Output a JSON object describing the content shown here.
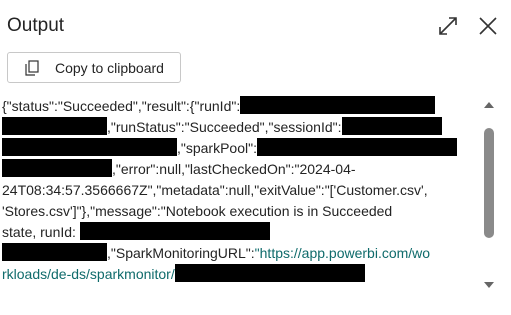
{
  "panel": {
    "title": "Output"
  },
  "toolbar": {
    "copy_label": "Copy to clipboard"
  },
  "icons": {
    "expand": "expand-icon",
    "close": "close-icon",
    "copy": "copy-icon"
  },
  "output": {
    "l1": "{\"status\":\"Succeeded\",\"result\":{\"runId\":",
    "l2": ",\"runStatus\":\"Succeeded\",\"sessionId\":",
    "l3": ",\"sparkPool\":",
    "l4": "\"2024-04-",
    "l4_mid": ",\"error\":null,\"lastCheckedOn\":",
    "l5": "24T08:34:57.3566667Z\",\"metadata\":null,\"exitValue\":\"['Customer.csv',",
    "l6": "'Stores.csv']\"},\"message\":\"Notebook execution is in Succeeded",
    "l7": "state, runId:",
    "l8": ",\"SparkMonitoringURL\":",
    "url_part1": "\"https://app.powerbi.com/wo",
    "url_part2": "rkloads/de-ds/sparkmonitor/"
  },
  "colors": {
    "link": "#0f6b6b",
    "redaction": "#000000"
  }
}
